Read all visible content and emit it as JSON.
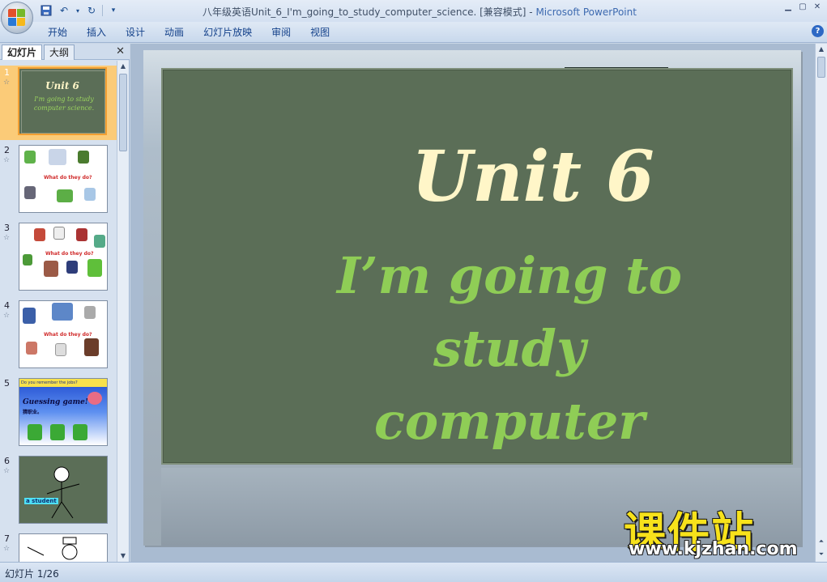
{
  "window": {
    "title": "八年级英语Unit_6_I'm_going_to_study_computer_science. [兼容模式]",
    "title_separator": "-",
    "app_name": "Microsoft PowerPoint"
  },
  "ribbon": {
    "tabs": [
      "开始",
      "插入",
      "设计",
      "动画",
      "幻灯片放映",
      "审阅",
      "视图"
    ]
  },
  "left_pane": {
    "tab_slides": "幻灯片",
    "tab_outline": "大纲",
    "close": "✕"
  },
  "thumbnails": [
    {
      "number": "1",
      "title": "Unit 6",
      "subtitle": "I'm going to study computer science."
    },
    {
      "number": "2",
      "caption": "What do they do?"
    },
    {
      "number": "3",
      "caption": "What do they do?"
    },
    {
      "number": "4",
      "caption": "What do they do?"
    },
    {
      "number": "5",
      "header": "Do you remember the jobs?",
      "title": "Guessing game!",
      "subtitle": "猜职业。"
    },
    {
      "number": "6",
      "label": "a student"
    },
    {
      "number": "7"
    }
  ],
  "slide": {
    "title": "Unit 6",
    "subtitle_line1": "I’m going to study",
    "subtitle_line2": "computer science."
  },
  "status": {
    "slide_counter": "幻灯片 1/26"
  },
  "watermark": {
    "cn": "课件站",
    "url": "www.kjzhan.com"
  },
  "colors": {
    "board": "#5b6e57",
    "title": "#fff6c8",
    "subtitle": "#8fcd56",
    "selected_thumb": "#fbcb78"
  }
}
